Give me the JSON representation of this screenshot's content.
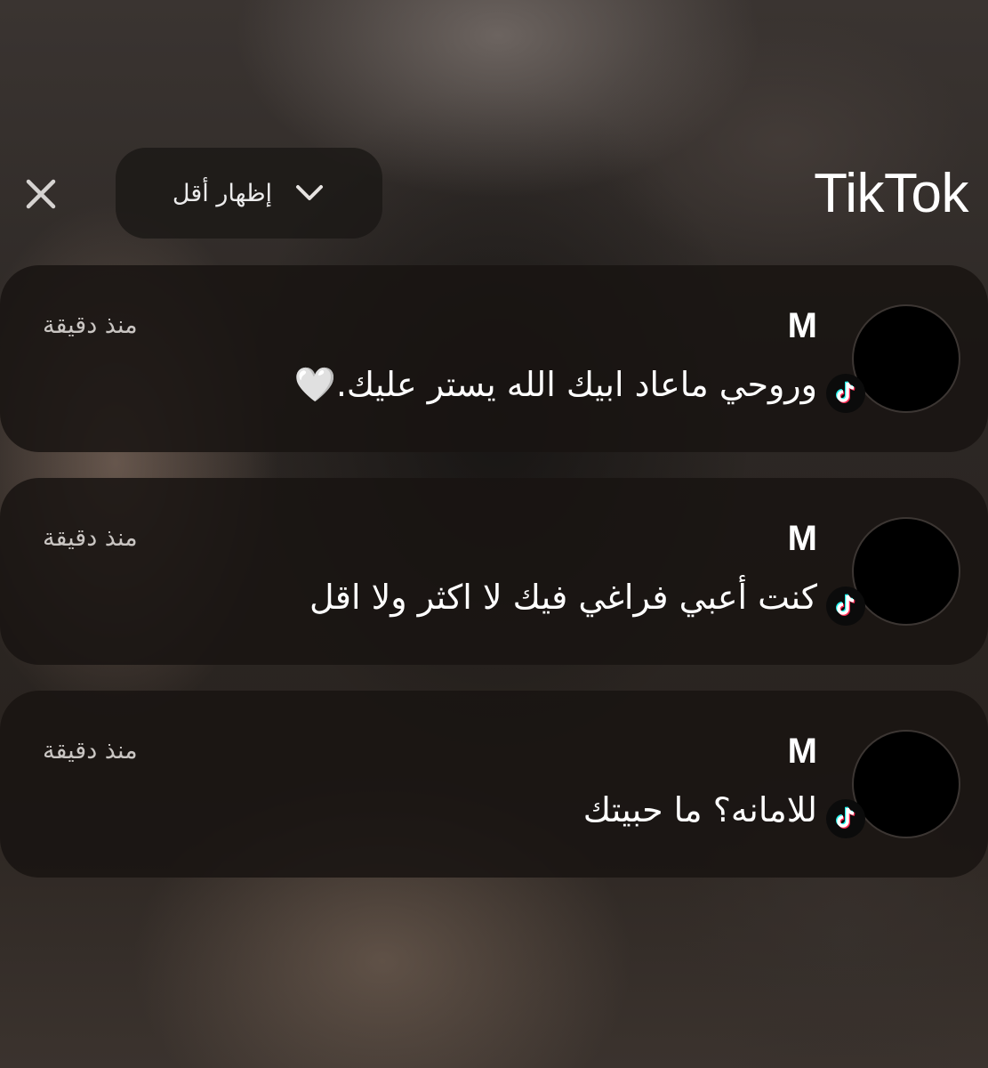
{
  "header": {
    "app_name": "TikTok",
    "toggle_label": "إظهار أقل",
    "chevron_icon": "chevron-down-icon",
    "close_icon": "close-icon"
  },
  "comments": [
    {
      "username": "M",
      "time": "منذ دقيقة",
      "text": "وروحي ماعاد ابيك الله يستر عليك.🤍"
    },
    {
      "username": "M",
      "time": "منذ دقيقة",
      "text": "كنت أعبي فراغي فيك لا اكثر ولا اقل"
    },
    {
      "username": "M",
      "time": "منذ دقيقة",
      "text": "للامانه؟ ما حبيتك"
    }
  ],
  "colors": {
    "card_bg": "#181412",
    "text": "#ffffff",
    "muted_text": "#c9c5c2",
    "tiktok_cyan": "#25f4ee",
    "tiktok_red": "#fe2c55"
  }
}
